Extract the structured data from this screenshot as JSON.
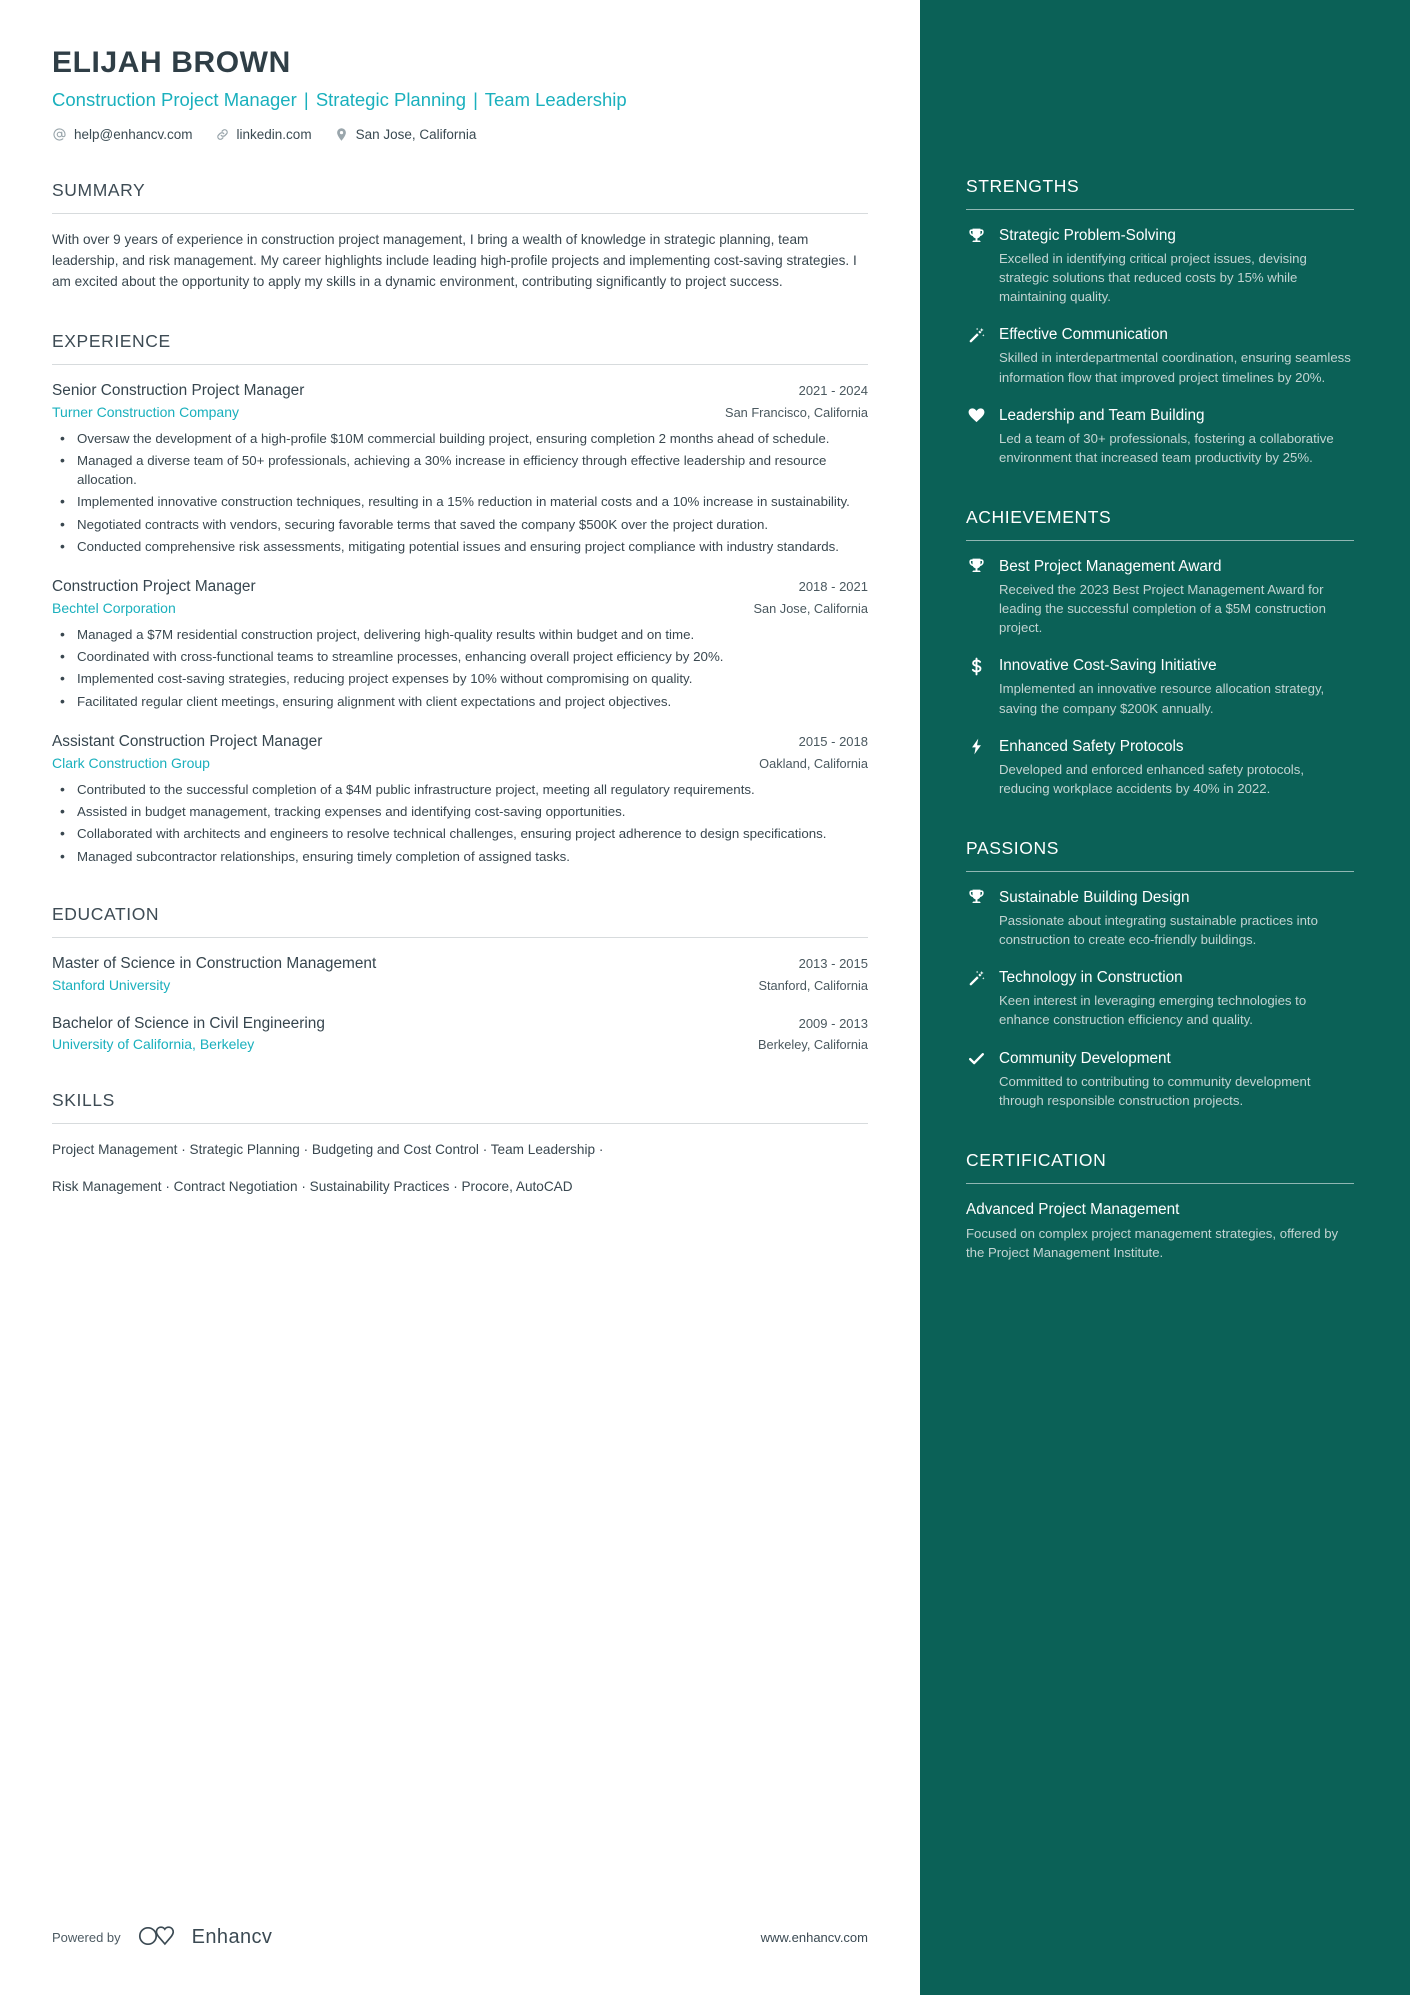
{
  "header": {
    "name": "ELIJAH BROWN",
    "headline_parts": [
      "Construction Project Manager",
      "Strategic Planning",
      "Team Leadership"
    ],
    "headline_separator": "|",
    "contacts": [
      {
        "icon": "at-sign-icon",
        "text": "help@enhancv.com"
      },
      {
        "icon": "link-icon",
        "text": "linkedin.com"
      },
      {
        "icon": "map-pin-icon",
        "text": "San Jose, California"
      }
    ]
  },
  "summary": {
    "title": "SUMMARY",
    "text": "With over 9 years of experience in construction project management, I bring a wealth of knowledge in strategic planning, team leadership, and risk management. My career highlights include leading high-profile projects and implementing cost-saving strategies. I am excited about the opportunity to apply my skills in a dynamic environment, contributing significantly to project success."
  },
  "experience": {
    "title": "EXPERIENCE",
    "entries": [
      {
        "role": "Senior Construction Project Manager",
        "dates": "2021 - 2024",
        "company": "Turner Construction Company",
        "location": "San Francisco, California",
        "bullets": [
          "Oversaw the development of a high-profile $10M commercial building project, ensuring completion 2 months ahead of schedule.",
          "Managed a diverse team of 50+ professionals, achieving a 30% increase in efficiency through effective leadership and resource allocation.",
          "Implemented innovative construction techniques, resulting in a 15% reduction in material costs and a 10% increase in sustainability.",
          "Negotiated contracts with vendors, securing favorable terms that saved the company $500K over the project duration.",
          "Conducted comprehensive risk assessments, mitigating potential issues and ensuring project compliance with industry standards."
        ]
      },
      {
        "role": "Construction Project Manager",
        "dates": "2018 - 2021",
        "company": "Bechtel Corporation",
        "location": "San Jose, California",
        "bullets": [
          "Managed a $7M residential construction project, delivering high-quality results within budget and on time.",
          "Coordinated with cross-functional teams to streamline processes, enhancing overall project efficiency by 20%.",
          "Implemented cost-saving strategies, reducing project expenses by 10% without compromising on quality.",
          "Facilitated regular client meetings, ensuring alignment with client expectations and project objectives."
        ]
      },
      {
        "role": "Assistant Construction Project Manager",
        "dates": "2015 - 2018",
        "company": "Clark Construction Group",
        "location": "Oakland, California",
        "bullets": [
          "Contributed to the successful completion of a $4M public infrastructure project, meeting all regulatory requirements.",
          "Assisted in budget management, tracking expenses and identifying cost-saving opportunities.",
          "Collaborated with architects and engineers to resolve technical challenges, ensuring project adherence to design specifications.",
          "Managed subcontractor relationships, ensuring timely completion of assigned tasks."
        ]
      }
    ]
  },
  "education": {
    "title": "EDUCATION",
    "entries": [
      {
        "degree": "Master of Science in Construction Management",
        "dates": "2013 - 2015",
        "school": "Stanford University",
        "location": "Stanford, California"
      },
      {
        "degree": "Bachelor of Science in Civil Engineering",
        "dates": "2009 - 2013",
        "school": "University of California, Berkeley",
        "location": "Berkeley, California"
      }
    ]
  },
  "skills": {
    "title": "SKILLS",
    "lines": [
      "Project Management · Strategic Planning · Budgeting and Cost Control · Team Leadership ·",
      "Risk Management · Contract Negotiation · Sustainability Practices · Procore, AutoCAD"
    ]
  },
  "footer": {
    "powered_by_label": "Powered by",
    "brand_name": "Enhancv",
    "brand_logo": "enhancv-infinity-heart-logo",
    "site_url": "www.enhancv.com"
  },
  "sidebar": {
    "strengths": {
      "title": "STRENGTHS",
      "items": [
        {
          "icon": "trophy-icon",
          "title": "Strategic Problem-Solving",
          "desc": "Excelled in identifying critical project issues, devising strategic solutions that reduced costs by 15% while maintaining quality."
        },
        {
          "icon": "magic-wand-icon",
          "title": "Effective Communication",
          "desc": "Skilled in interdepartmental coordination, ensuring seamless information flow that improved project timelines by 20%."
        },
        {
          "icon": "heart-icon",
          "title": "Leadership and Team Building",
          "desc": "Led a team of 30+ professionals, fostering a collaborative environment that increased team productivity by 25%."
        }
      ]
    },
    "achievements": {
      "title": "ACHIEVEMENTS",
      "items": [
        {
          "icon": "trophy-icon",
          "title": "Best Project Management Award",
          "desc": "Received the 2023 Best Project Management Award for leading the successful completion of a $5M construction project."
        },
        {
          "icon": "dollar-sign-icon",
          "title": "Innovative Cost-Saving Initiative",
          "desc": "Implemented an innovative resource allocation strategy, saving the company $200K annually."
        },
        {
          "icon": "lightning-bolt-icon",
          "title": "Enhanced Safety Protocols",
          "desc": "Developed and enforced enhanced safety protocols, reducing workplace accidents by 40% in 2022."
        }
      ]
    },
    "passions": {
      "title": "PASSIONS",
      "items": [
        {
          "icon": "trophy-icon",
          "title": "Sustainable Building Design",
          "desc": "Passionate about integrating sustainable practices into construction to create eco-friendly buildings."
        },
        {
          "icon": "magic-wand-icon",
          "title": "Technology in Construction",
          "desc": "Keen interest in leveraging emerging technologies to enhance construction efficiency and quality."
        },
        {
          "icon": "check-icon",
          "title": "Community Development",
          "desc": "Committed to contributing to community development through responsible construction projects."
        }
      ]
    },
    "certification": {
      "title": "CERTIFICATION",
      "name": "Advanced Project Management",
      "desc": "Focused on complex project management strategies, offered by the Project Management Institute."
    }
  },
  "colors": {
    "accent_teal": "#1ab0bd",
    "sidebar_bg": "#0b6157",
    "text_dark": "#36454e",
    "sidebar_muted": "#c3d4d2"
  }
}
